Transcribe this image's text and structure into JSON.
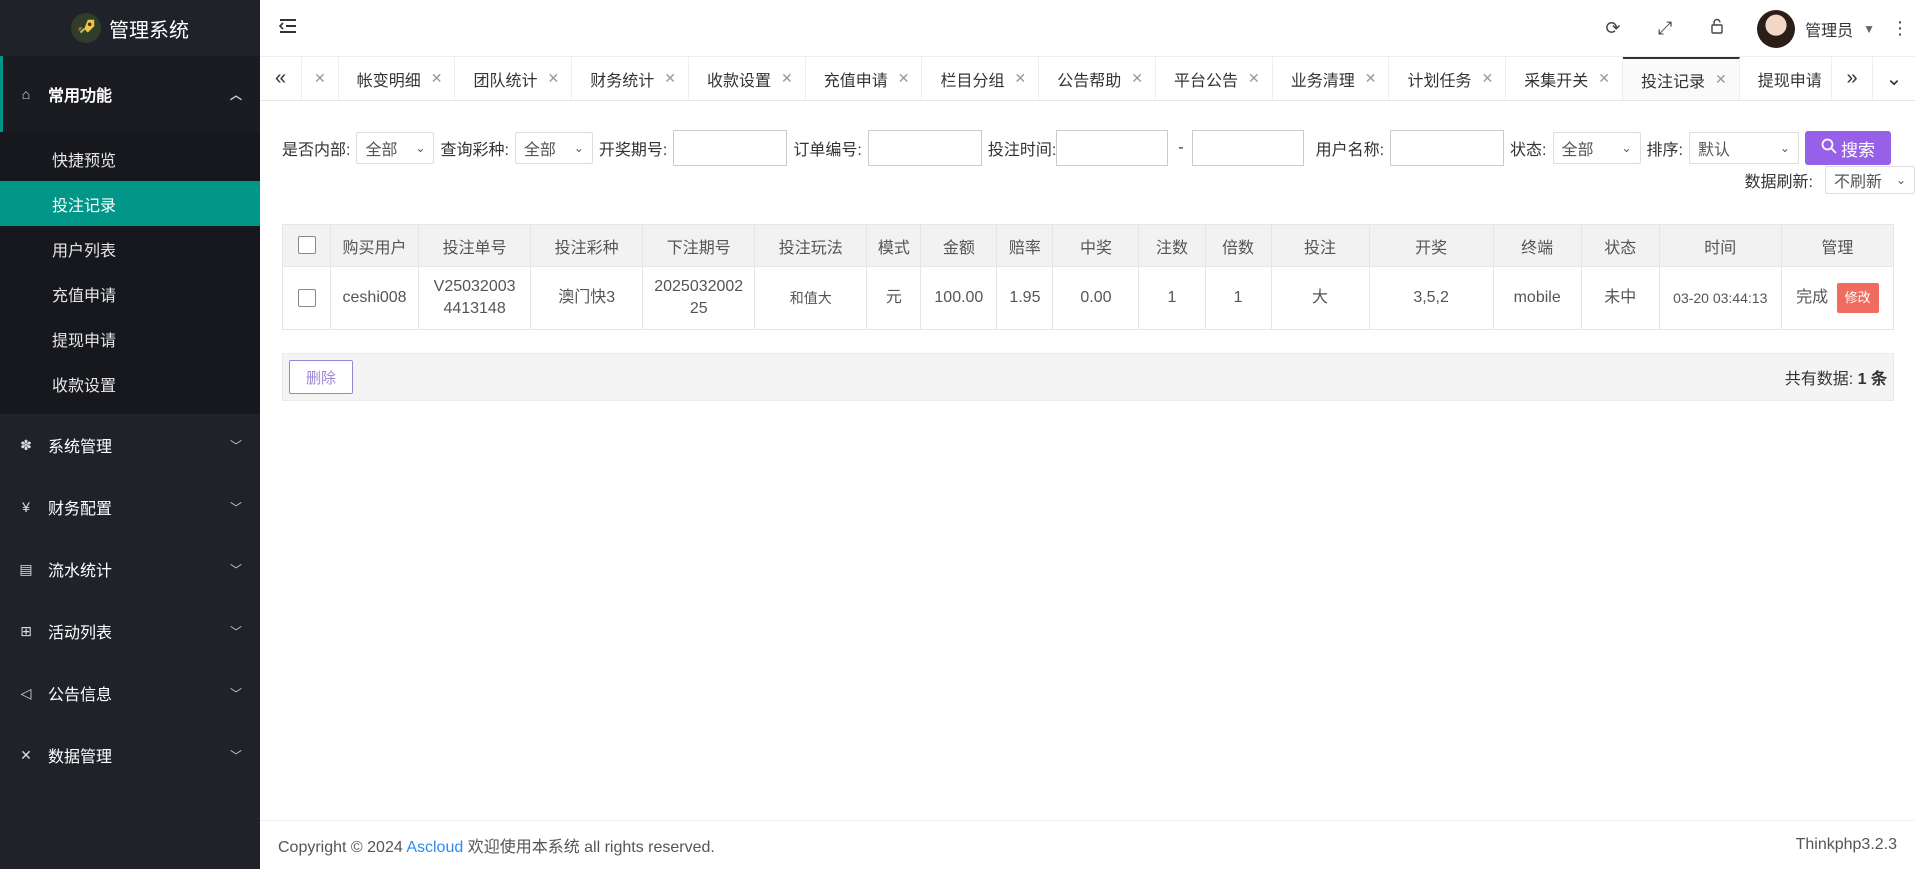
{
  "app": {
    "title": "管理系统"
  },
  "sidebar": {
    "groups": [
      {
        "label": "常用功能",
        "icon": "home-icon",
        "open": true,
        "items": [
          {
            "label": "快捷预览"
          },
          {
            "label": "投注记录",
            "active": true
          },
          {
            "label": "用户列表"
          },
          {
            "label": "充值申请"
          },
          {
            "label": "提现申请"
          },
          {
            "label": "收款设置"
          }
        ]
      },
      {
        "label": "系统管理",
        "icon": "gear-icon"
      },
      {
        "label": "财务配置",
        "icon": "yen-icon"
      },
      {
        "label": "流水统计",
        "icon": "clipboard-icon"
      },
      {
        "label": "活动列表",
        "icon": "gift-icon"
      },
      {
        "label": "公告信息",
        "icon": "speaker-icon"
      },
      {
        "label": "数据管理",
        "icon": "tools-icon"
      }
    ]
  },
  "header": {
    "user_name": "管理员"
  },
  "tabs": [
    {
      "label": "帐变明细"
    },
    {
      "label": "团队统计"
    },
    {
      "label": "财务统计"
    },
    {
      "label": "收款设置"
    },
    {
      "label": "充值申请"
    },
    {
      "label": "栏目分组"
    },
    {
      "label": "公告帮助"
    },
    {
      "label": "平台公告"
    },
    {
      "label": "业务清理"
    },
    {
      "label": "计划任务"
    },
    {
      "label": "采集开关"
    },
    {
      "label": "投注记录",
      "active": true
    },
    {
      "label": "提现申请"
    }
  ],
  "filters": {
    "internal_label": "是否内部:",
    "internal_value": "全部",
    "lottery_label": "查询彩种:",
    "lottery_value": "全部",
    "period_label": "开奖期号:",
    "order_label": "订单编号:",
    "time_label": "投注时间:",
    "time_sep": "-",
    "username_label": "用户名称:",
    "status_label": "状态:",
    "status_value": "全部",
    "sort_label": "排序:",
    "sort_value": "默认",
    "search_button": "搜索",
    "refresh_label": "数据刷新:",
    "refresh_value": "不刷新"
  },
  "table": {
    "headers": [
      "购买用户",
      "投注单号",
      "投注彩种",
      "下注期号",
      "投注玩法",
      "模式",
      "金额",
      "赔率",
      "中奖",
      "注数",
      "倍数",
      "投注",
      "开奖",
      "终端",
      "状态",
      "时间",
      "管理"
    ],
    "rows": [
      {
        "user": "ceshi008",
        "order_no_1": "V25032003",
        "order_no_2": "4413148",
        "lottery": "澳门快3",
        "period_1": "2025032002",
        "period_2": "25",
        "play": "和值大",
        "mode": "元",
        "amount": "100.00",
        "odds": "1.95",
        "win": "0.00",
        "count": "1",
        "multiple": "1",
        "bet": "大",
        "draw": "3,5,2",
        "terminal": "mobile",
        "status": "未中",
        "time": "03-20 03:44:13",
        "manage_done": "完成",
        "manage_edit": "修改"
      }
    ]
  },
  "actions": {
    "delete_button": "删除",
    "total_prefix": "共有数据:",
    "total_count": "1",
    "total_suffix": "条"
  },
  "footer": {
    "copyright": "Copyright © 2024",
    "brand": "Ascloud",
    "tail": "欢迎使用本系统 all rights reserved.",
    "version": "Thinkphp3.2.3"
  },
  "colors": {
    "sidebar_bg": "#20222a",
    "accent": "#009688",
    "search_button": "#9661e8",
    "edit_button": "#f06c5f",
    "status_lose": "#e32b2b"
  }
}
